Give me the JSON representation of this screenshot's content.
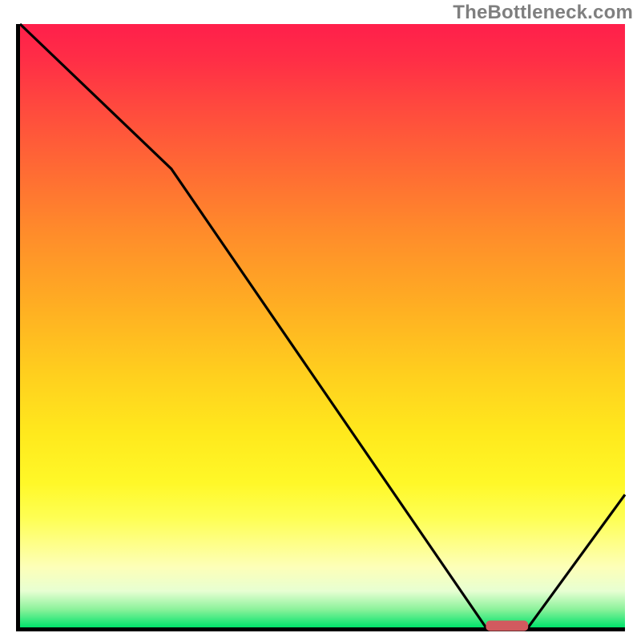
{
  "watermark": "TheBottleneck.com",
  "chart_data": {
    "type": "line",
    "title": "",
    "xlabel": "",
    "ylabel": "",
    "xlim": [
      0,
      100
    ],
    "ylim": [
      0,
      100
    ],
    "grid": false,
    "series": [
      {
        "name": "bottleneck-curve",
        "color": "#000000",
        "x": [
          0,
          25,
          77,
          84,
          100
        ],
        "y": [
          100,
          76,
          0,
          0,
          22
        ]
      }
    ],
    "marker": {
      "name": "optimal-band",
      "color": "#d25a5f",
      "x_start": 77,
      "x_end": 84,
      "y": 0,
      "thickness_pct": 1.2
    },
    "background_gradient": {
      "top": "#ff1f4b",
      "middle": "#ffe91d",
      "bottom": "#00e36b"
    }
  }
}
